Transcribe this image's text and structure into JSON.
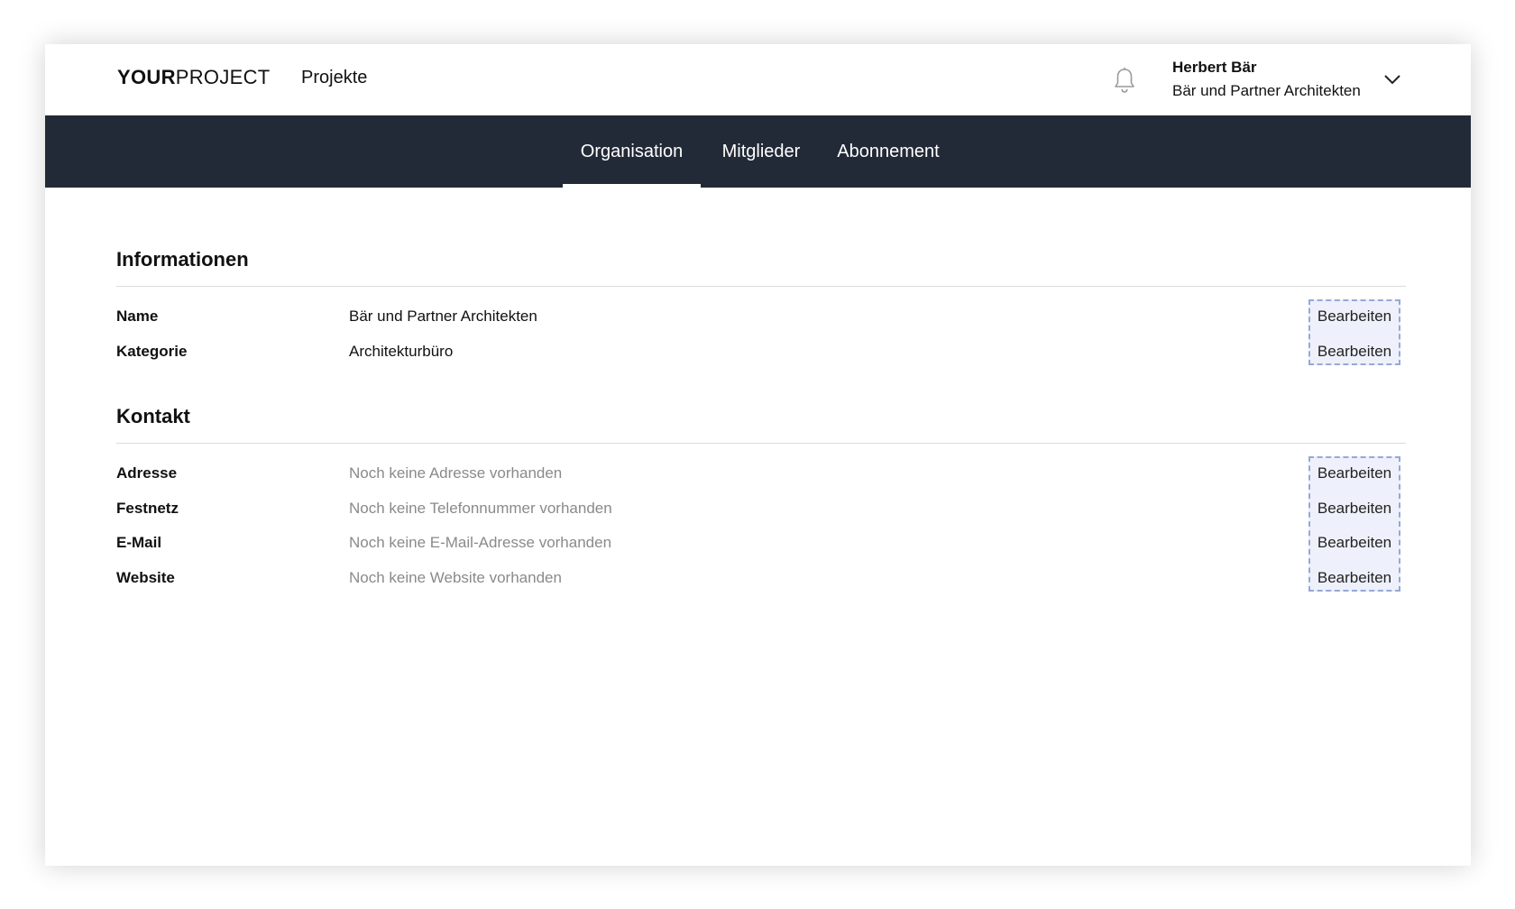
{
  "header": {
    "logo_bold": "YOUR",
    "logo_light": "PROJECT",
    "projects_link": "Projekte",
    "bell_icon": "bell-icon",
    "user_name": "Herbert Bär",
    "user_org": "Bär und Partner Architekten",
    "menu_icon": "chevron-down-icon"
  },
  "tabs": [
    {
      "label": "Organisation",
      "active": true
    },
    {
      "label": "Mitglieder",
      "active": false
    },
    {
      "label": "Abonnement",
      "active": false
    }
  ],
  "informationen": {
    "title": "Informationen",
    "rows": [
      {
        "label": "Name",
        "value": "Bär und Partner Architekten",
        "action": "Bearbeiten"
      },
      {
        "label": "Kategorie",
        "value": "Architekturbüro",
        "action": "Bearbeiten"
      }
    ]
  },
  "kontakt": {
    "title": "Kontakt",
    "rows": [
      {
        "label": "Adresse",
        "value": "Noch keine Adresse vorhanden",
        "action": "Bearbeiten"
      },
      {
        "label": "Festnetz",
        "value": "Noch keine Telefonnummer vorhanden",
        "action": "Bearbeiten"
      },
      {
        "label": "E-Mail",
        "value": "Noch keine E-Mail-Adresse vorhanden",
        "action": "Bearbeiten"
      },
      {
        "label": "Website",
        "value": "Noch keine Website vorhanden",
        "action": "Bearbeiten"
      }
    ]
  },
  "colors": {
    "navbar": "#232a37",
    "edit_highlight": "#eef1fb",
    "edit_border": "#96a8d8",
    "placeholder_text": "#8a8a8a"
  }
}
